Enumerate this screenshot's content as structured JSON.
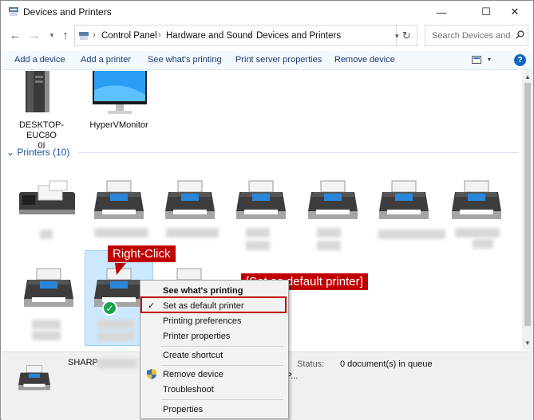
{
  "window": {
    "title": "Devices and Printers",
    "min": "—",
    "max": "☐",
    "close": "✕"
  },
  "nav": {
    "back": "←",
    "forward": "→",
    "dropdown": "▾",
    "up": "↑",
    "refresh": "↻"
  },
  "breadcrumb": [
    "Control Panel",
    "Hardware and Sound",
    "Devices and Printers"
  ],
  "breadcrumb_sep": "›",
  "search": {
    "placeholder": "Search Devices and ..."
  },
  "commands": [
    "Add a device",
    "Add a printer",
    "See what's printing",
    "Print server properties",
    "Remove device"
  ],
  "devices": [
    {
      "label": "DESKTOP-EUC8O\n0I"
    },
    {
      "label": "HyperVMonitor"
    }
  ],
  "printers_group": {
    "label": "Printers (10)",
    "chevron": "⌄"
  },
  "callouts": {
    "right_click": "Right-Click",
    "set_default": "[Set as default printer]"
  },
  "status": {
    "name": "SHARP",
    "status_label": "Status:",
    "status_value": "0 document(s) in queue",
    "fragment": "N SP..."
  },
  "context_menu": {
    "items": [
      "See what's printing",
      "Set as default printer",
      "Printing preferences",
      "Printer properties",
      "Create shortcut",
      "Remove device",
      "Troubleshoot",
      "Properties"
    ],
    "checked": "✓"
  },
  "colors": {
    "accent": "#1e4f9c",
    "callout": "#c00000",
    "selection": "#cce8ff",
    "check": "#17a34a"
  }
}
